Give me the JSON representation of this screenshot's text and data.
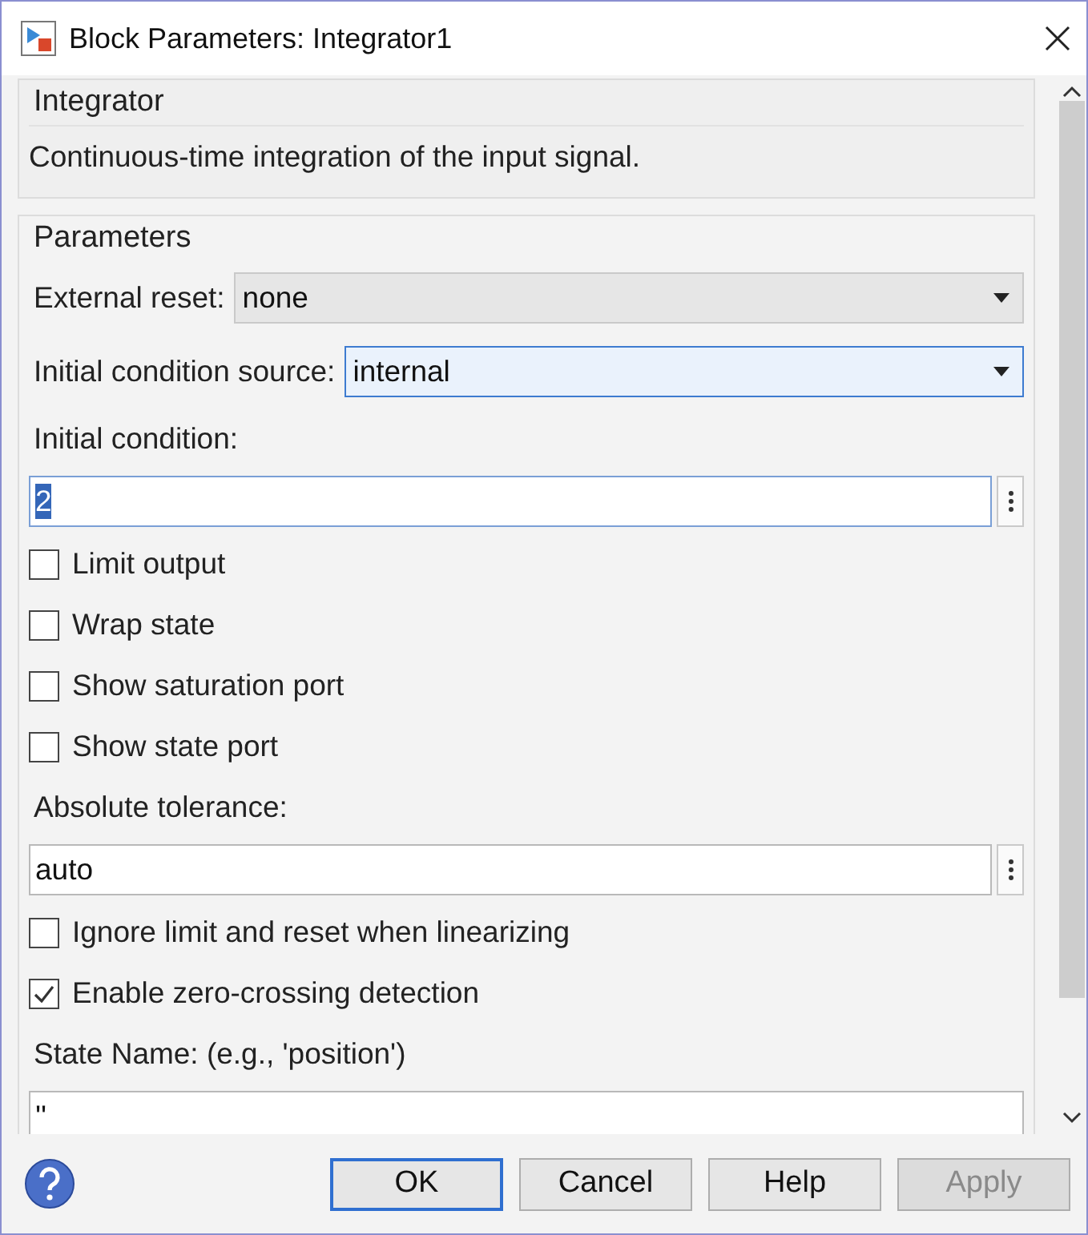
{
  "window": {
    "title": "Block Parameters: Integrator1"
  },
  "block": {
    "title": "Integrator",
    "description": "Continuous-time integration of the input signal."
  },
  "parameters": {
    "title": "Parameters",
    "items": [
      {
        "kind": "dropdown",
        "label": "External reset:",
        "value": "none",
        "focused": false
      },
      {
        "kind": "dropdown",
        "label": "Initial condition source:",
        "value": "internal",
        "focused": true
      },
      {
        "kind": "field",
        "label": "Initial condition:",
        "value": "2",
        "text_selected": true,
        "has_menu": true
      },
      {
        "kind": "checkbox",
        "label": "Limit output",
        "checked": false
      },
      {
        "kind": "checkbox",
        "label": "Wrap state",
        "checked": false
      },
      {
        "kind": "checkbox",
        "label": "Show saturation port",
        "checked": false
      },
      {
        "kind": "checkbox",
        "label": "Show state port",
        "checked": false
      },
      {
        "kind": "field",
        "label": "Absolute tolerance:",
        "value": "auto",
        "text_selected": false,
        "has_menu": true
      },
      {
        "kind": "checkbox",
        "label": "Ignore limit and reset when linearizing",
        "checked": false
      },
      {
        "kind": "checkbox",
        "label": "Enable zero-crossing detection",
        "checked": true
      },
      {
        "kind": "field",
        "label": "State Name: (e.g., 'position')",
        "value": "''",
        "text_selected": false,
        "has_menu": false
      }
    ]
  },
  "buttons": [
    {
      "label": "OK",
      "default": true,
      "disabled": false
    },
    {
      "label": "Cancel",
      "default": false,
      "disabled": false
    },
    {
      "label": "Help",
      "default": false,
      "disabled": false
    },
    {
      "label": "Apply",
      "default": false,
      "disabled": true
    }
  ]
}
